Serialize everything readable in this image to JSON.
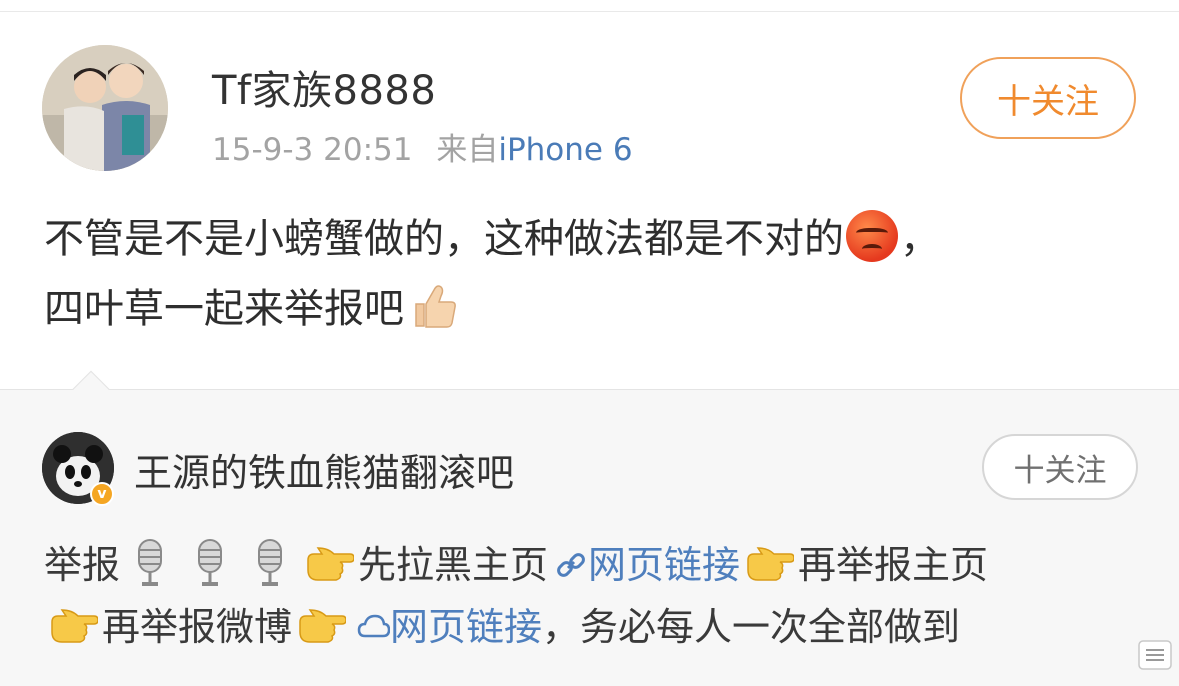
{
  "post": {
    "username": "Tf家族8888",
    "timestamp": "15-9-3 20:51",
    "source_prefix": "来自",
    "source": "iPhone 6",
    "follow_label": "十关注",
    "text_line1": "不管是不是小螃蟹做的，这种做法都是不对的",
    "text_line1_end": "，",
    "text_line2": "四叶草一起来举报吧"
  },
  "repost": {
    "username": "王源的铁血熊猫翻滚吧",
    "verified_badge": "v",
    "follow_label": "十关注",
    "t1": "举报",
    "t2": "先拉黑主页",
    "link1": "网页链接",
    "t3": "再举报主页",
    "t4": "再举报微博",
    "link2": "网页链接",
    "t5": "，务必每人一次全部做到"
  },
  "colors": {
    "link": "#4f7fbd",
    "source": "#4a7bb7",
    "follow_accent": "#f08a2e",
    "meta": "#a3a3a3"
  },
  "icons": [
    "angry-emoji-icon",
    "thumbs-up-emoji-icon",
    "microphone-icon",
    "pointing-hand-icon",
    "link-icon",
    "cloud-icon",
    "expand-icon"
  ]
}
